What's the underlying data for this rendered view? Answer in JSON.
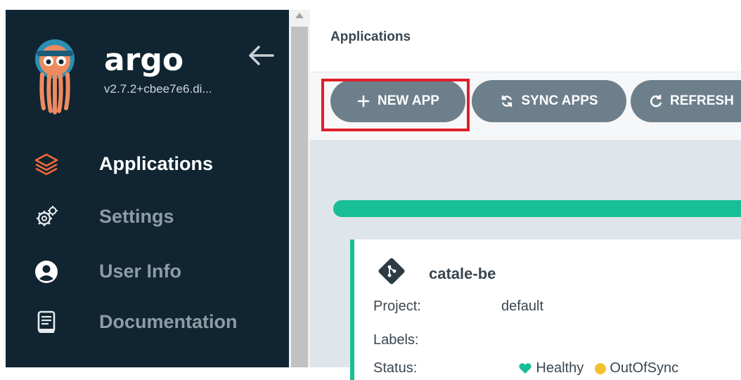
{
  "sidebar": {
    "brand": "argo",
    "version": "v2.7.2+cbee7e6.di...",
    "items": [
      {
        "label": "Applications",
        "icon": "layers-icon",
        "active": true
      },
      {
        "label": "Settings",
        "icon": "gears-icon",
        "active": false
      },
      {
        "label": "User Info",
        "icon": "user-circle-icon",
        "active": false
      },
      {
        "label": "Documentation",
        "icon": "book-icon",
        "active": false
      }
    ]
  },
  "header": {
    "title": "Applications"
  },
  "toolbar": {
    "new_app": "NEW APP",
    "sync_apps": "SYNC APPS",
    "refresh": "REFRESH"
  },
  "app_card": {
    "name": "catale-be",
    "project_label": "Project:",
    "project_value": "default",
    "labels_label": "Labels:",
    "status_label": "Status:",
    "health": "Healthy",
    "sync": "OutOfSync"
  },
  "colors": {
    "sidebar_bg": "#102431",
    "accent_orange": "#f06b3a",
    "button_bg": "#6d7f8b",
    "healthy_green": "#18be94",
    "highlight_red": "#e01e2b"
  }
}
